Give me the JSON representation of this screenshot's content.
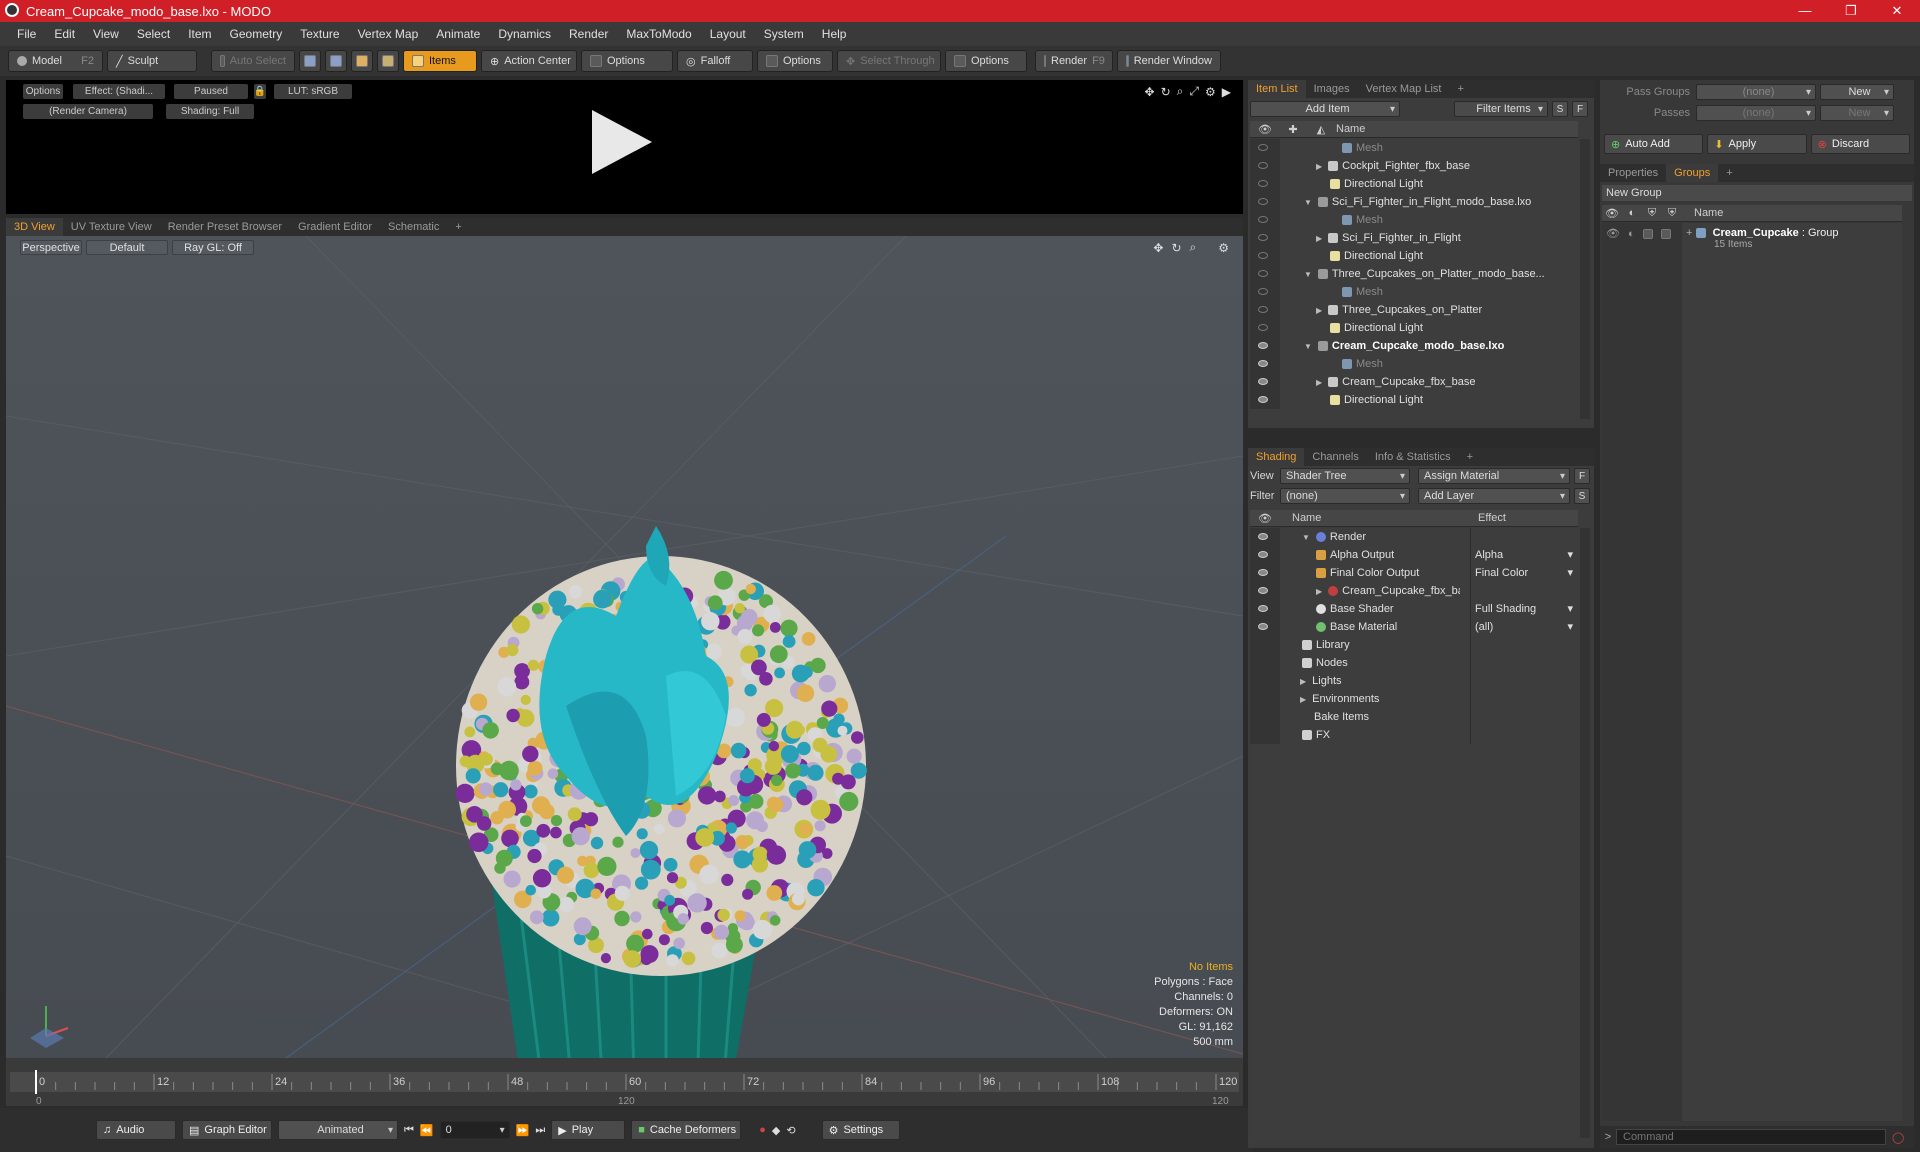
{
  "window": {
    "title": "Cream_Cupcake_modo_base.lxo - MODO",
    "minimize": "—",
    "maximize": "❐",
    "close": "✕"
  },
  "menu": [
    "File",
    "Edit",
    "View",
    "Select",
    "Item",
    "Geometry",
    "Texture",
    "Vertex Map",
    "Animate",
    "Dynamics",
    "Render",
    "MaxToModo",
    "Layout",
    "System",
    "Help"
  ],
  "toolbar": {
    "model": "Model",
    "model_key": "F2",
    "sculpt": "Sculpt",
    "auto_select": "Auto Select",
    "items": "Items",
    "action_center": "Action Center",
    "options1": "Options",
    "falloff": "Falloff",
    "options2": "Options",
    "select_through": "Select Through",
    "options3": "Options",
    "render": "Render",
    "render_key": "F9",
    "render_window": "Render Window"
  },
  "preview": {
    "options": "Options",
    "effect": "Effect: (Shadi...",
    "paused": "Paused",
    "lut": "LUT: sRGB",
    "camera": "(Render Camera)",
    "shading": "Shading: Full"
  },
  "view_tabs": [
    "3D View",
    "UV Texture View",
    "Render Preset Browser",
    "Gradient Editor",
    "Schematic",
    "+"
  ],
  "viewport": {
    "perspective": "Perspective",
    "default": "Default",
    "raygl": "Ray GL: Off",
    "stats": {
      "no_items": "No Items",
      "polygons": "Polygons : Face",
      "channels": "Channels: 0",
      "deformers": "Deformers: ON",
      "gl": "GL: 91,162",
      "size": "500 mm"
    }
  },
  "timeline": {
    "ticks": [
      "0",
      "12",
      "24",
      "36",
      "48",
      "60",
      "72",
      "84",
      "96",
      "108",
      "120"
    ],
    "start": "0",
    "end": "120",
    "mid": "120"
  },
  "bottom": {
    "audio": "Audio",
    "graph_editor": "Graph Editor",
    "animated": "Animated",
    "frame": "0",
    "play": "Play",
    "cache": "Cache Deformers",
    "settings": "Settings"
  },
  "item_list": {
    "tabs": [
      "Item List",
      "Images",
      "Vertex Map List",
      "+"
    ],
    "add_item": "Add Item",
    "filter_items": "Filter Items",
    "s": "S",
    "f": "F",
    "col_name": "Name",
    "rows": [
      {
        "label": "Mesh",
        "indent": 3,
        "kind": "mesh",
        "dim": true,
        "eye": false
      },
      {
        "label": "Cockpit_Fighter_fbx_base",
        "indent": 2,
        "kind": "loc",
        "arrow": "▶",
        "eye": false
      },
      {
        "label": "Directional Light",
        "indent": 2,
        "kind": "light",
        "eye": false
      },
      {
        "label": "Sci_Fi_Fighter_in_Flight_modo_base.lxo",
        "indent": 1,
        "kind": "scene",
        "arrow": "▼",
        "eye": false
      },
      {
        "label": "Mesh",
        "indent": 3,
        "kind": "mesh",
        "dim": true,
        "eye": false
      },
      {
        "label": "Sci_Fi_Fighter_in_Flight",
        "indent": 2,
        "kind": "loc",
        "arrow": "▶",
        "eye": false
      },
      {
        "label": "Directional Light",
        "indent": 2,
        "kind": "light",
        "eye": false
      },
      {
        "label": "Three_Cupcakes_on_Platter_modo_base...",
        "indent": 1,
        "kind": "scene",
        "arrow": "▼",
        "eye": false
      },
      {
        "label": "Mesh",
        "indent": 3,
        "kind": "mesh",
        "dim": true,
        "eye": false
      },
      {
        "label": "Three_Cupcakes_on_Platter",
        "indent": 2,
        "kind": "loc",
        "arrow": "▶",
        "eye": false
      },
      {
        "label": "Directional Light",
        "indent": 2,
        "kind": "light",
        "eye": false
      },
      {
        "label": "Cream_Cupcake_modo_base.lxo",
        "indent": 1,
        "kind": "scene",
        "arrow": "▼",
        "bold": true,
        "eye": true
      },
      {
        "label": "Mesh",
        "indent": 3,
        "kind": "mesh",
        "dim": true,
        "eye": true
      },
      {
        "label": "Cream_Cupcake_fbx_base",
        "indent": 2,
        "kind": "loc",
        "arrow": "▶",
        "eye": true
      },
      {
        "label": "Directional Light",
        "indent": 2,
        "kind": "light",
        "eye": true
      }
    ]
  },
  "shading": {
    "tabs": [
      "Shading",
      "Channels",
      "Info & Statistics",
      "+"
    ],
    "view_label": "View",
    "view_value": "Shader Tree",
    "assign": "Assign Material",
    "f": "F",
    "filter_label": "Filter",
    "filter_value": "(none)",
    "add_layer": "Add Layer",
    "s": "S",
    "col_name": "Name",
    "col_effect": "Effect",
    "rows": [
      {
        "label": "Render",
        "indent": 0,
        "arrow": "▼",
        "kind": "render",
        "effect": "",
        "eye": true
      },
      {
        "label": "Alpha Output",
        "indent": 1,
        "kind": "output",
        "effect": "Alpha",
        "eye": true
      },
      {
        "label": "Final Color Output",
        "indent": 1,
        "kind": "output",
        "effect": "Final Color",
        "eye": true
      },
      {
        "label": "Cream_Cupcake_fbx_base ...",
        "indent": 1,
        "arrow": "▶",
        "kind": "mat",
        "effect": "",
        "eye": true
      },
      {
        "label": "Base Shader",
        "indent": 1,
        "kind": "shader",
        "effect": "Full Shading",
        "eye": true
      },
      {
        "label": "Base Material",
        "indent": 1,
        "kind": "basemat",
        "effect": "(all)",
        "eye": true
      },
      {
        "label": "Library",
        "indent": 0,
        "kind": "folder",
        "effect": "",
        "eye": false,
        "noeye": true
      },
      {
        "label": "Nodes",
        "indent": 0,
        "kind": "folder",
        "effect": "",
        "eye": false,
        "noeye": true
      },
      {
        "label": "Lights",
        "indent": -1,
        "arrow": "▶",
        "kind": "none",
        "effect": "",
        "eye": false,
        "noeye": true
      },
      {
        "label": "Environments",
        "indent": -1,
        "arrow": "▶",
        "kind": "none",
        "effect": "",
        "eye": false,
        "noeye": true
      },
      {
        "label": "Bake Items",
        "indent": -1,
        "kind": "none",
        "effect": "",
        "eye": false,
        "noeye": true
      },
      {
        "label": "FX",
        "indent": 0,
        "kind": "fx",
        "effect": "",
        "eye": false,
        "noeye": true
      }
    ]
  },
  "groups": {
    "pass_groups": "Pass Groups",
    "pass_value": "(none)",
    "new": "New",
    "passes": "Passes",
    "passes_value": "(none)",
    "new2": "New",
    "auto_add": "Auto Add",
    "apply": "Apply",
    "discard": "Discard",
    "tabs": [
      "Properties",
      "Groups",
      "+"
    ],
    "new_group": "New Group",
    "col_name": "Name",
    "group_name": "Cream_Cupcake",
    "group_type": ": Group",
    "group_count": "15 Items"
  },
  "command": {
    "placeholder": "Command",
    "arrow": ">"
  }
}
